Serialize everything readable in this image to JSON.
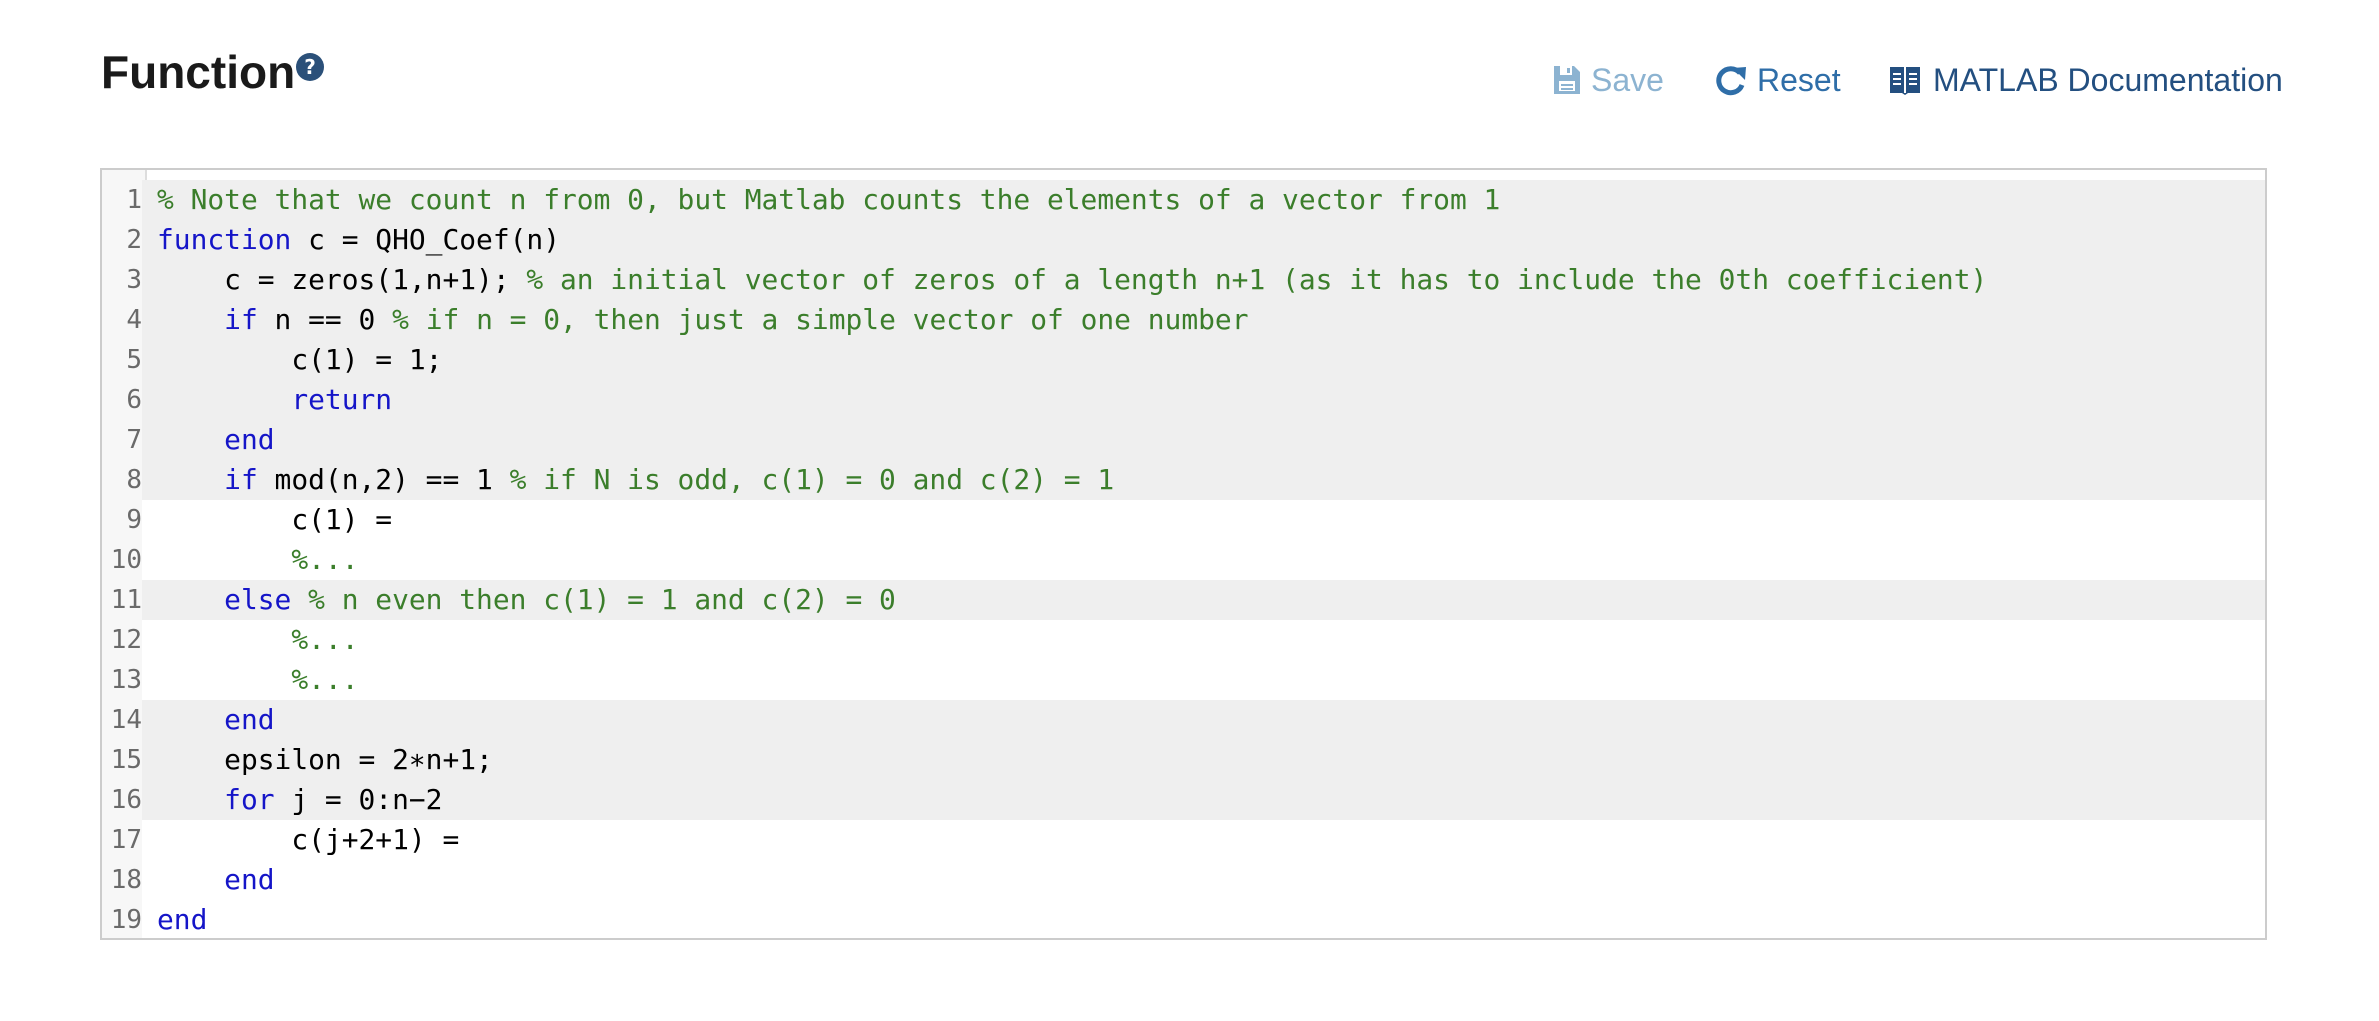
{
  "header": {
    "title": "Function",
    "help_icon": "question-circle-icon",
    "toolbar": {
      "save": {
        "label": "Save",
        "icon": "floppy-disk-icon",
        "enabled": false
      },
      "reset": {
        "label": "Reset",
        "icon": "refresh-icon"
      },
      "docs": {
        "label": "MATLAB Documentation",
        "icon": "book-icon"
      }
    }
  },
  "colors": {
    "keyword": "#1515c8",
    "comment": "#3b7e2b",
    "text": "#000000",
    "locked_line_bg": "#efefef",
    "editable_line_bg": "#ffffff",
    "accent": "#2b5079"
  },
  "editor": {
    "lines": [
      {
        "number": "1",
        "locked": true,
        "tokens": [
          {
            "t": "cm",
            "v": "% Note that we count n from 0, but Matlab counts the elements of a vector from 1"
          }
        ]
      },
      {
        "number": "2",
        "locked": true,
        "tokens": [
          {
            "t": "kw",
            "v": "function"
          },
          {
            "t": "tx",
            "v": " c = QHO_Coef(n)"
          }
        ]
      },
      {
        "number": "3",
        "locked": true,
        "tokens": [
          {
            "t": "tx",
            "v": "    c = zeros(1,n+1); "
          },
          {
            "t": "cm",
            "v": "% an initial vector of zeros of a length n+1 (as it has to include the 0th coefficient)"
          }
        ]
      },
      {
        "number": "4",
        "locked": true,
        "tokens": [
          {
            "t": "tx",
            "v": "    "
          },
          {
            "t": "kw",
            "v": "if"
          },
          {
            "t": "tx",
            "v": " n == 0 "
          },
          {
            "t": "cm",
            "v": "% if n = 0, then just a simple vector of one number"
          }
        ]
      },
      {
        "number": "5",
        "locked": true,
        "tokens": [
          {
            "t": "tx",
            "v": "        c(1) = 1;"
          }
        ]
      },
      {
        "number": "6",
        "locked": true,
        "tokens": [
          {
            "t": "tx",
            "v": "        "
          },
          {
            "t": "kw",
            "v": "return"
          }
        ]
      },
      {
        "number": "7",
        "locked": true,
        "tokens": [
          {
            "t": "tx",
            "v": "    "
          },
          {
            "t": "kw",
            "v": "end"
          }
        ]
      },
      {
        "number": "8",
        "locked": true,
        "tokens": [
          {
            "t": "tx",
            "v": "    "
          },
          {
            "t": "kw",
            "v": "if"
          },
          {
            "t": "tx",
            "v": " mod(n,2) == 1 "
          },
          {
            "t": "cm",
            "v": "% if N is odd, c(1) = 0 and c(2) = 1"
          }
        ]
      },
      {
        "number": "9",
        "locked": false,
        "tokens": [
          {
            "t": "tx",
            "v": "        c(1) = "
          }
        ]
      },
      {
        "number": "10",
        "locked": false,
        "tokens": [
          {
            "t": "tx",
            "v": "        "
          },
          {
            "t": "cm",
            "v": "%..."
          }
        ]
      },
      {
        "number": "11",
        "locked": true,
        "tokens": [
          {
            "t": "tx",
            "v": "    "
          },
          {
            "t": "kw",
            "v": "else"
          },
          {
            "t": "tx",
            "v": " "
          },
          {
            "t": "cm",
            "v": "% n even then c(1) = 1 and c(2) = 0"
          }
        ]
      },
      {
        "number": "12",
        "locked": false,
        "tokens": [
          {
            "t": "tx",
            "v": "        "
          },
          {
            "t": "cm",
            "v": "%..."
          }
        ]
      },
      {
        "number": "13",
        "locked": false,
        "tokens": [
          {
            "t": "tx",
            "v": "        "
          },
          {
            "t": "cm",
            "v": "%..."
          }
        ]
      },
      {
        "number": "14",
        "locked": true,
        "tokens": [
          {
            "t": "tx",
            "v": "    "
          },
          {
            "t": "kw",
            "v": "end"
          }
        ]
      },
      {
        "number": "15",
        "locked": true,
        "tokens": [
          {
            "t": "tx",
            "v": "    epsilon = 2∗n+1;"
          }
        ]
      },
      {
        "number": "16",
        "locked": true,
        "tokens": [
          {
            "t": "tx",
            "v": "    "
          },
          {
            "t": "kw",
            "v": "for"
          },
          {
            "t": "tx",
            "v": " j = 0:n−2"
          }
        ]
      },
      {
        "number": "17",
        "locked": false,
        "tokens": [
          {
            "t": "tx",
            "v": "        c(j+2+1) = "
          }
        ]
      },
      {
        "number": "18",
        "locked": false,
        "tokens": [
          {
            "t": "tx",
            "v": "    "
          },
          {
            "t": "kw",
            "v": "end"
          }
        ]
      },
      {
        "number": "19",
        "locked": false,
        "tokens": [
          {
            "t": "kw",
            "v": "end"
          }
        ]
      }
    ]
  }
}
